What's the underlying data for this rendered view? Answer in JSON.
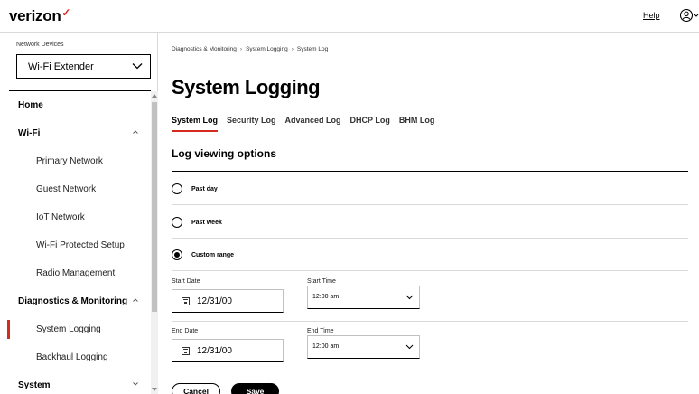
{
  "header": {
    "logo": "verizon",
    "help_label": "Help"
  },
  "sidebar": {
    "network_devices_label": "Network Devices",
    "device_selected": "Wi-Fi Extender",
    "items": [
      {
        "label": "Home",
        "level": "top"
      },
      {
        "label": "Wi-Fi",
        "level": "top",
        "caret": "up"
      },
      {
        "label": "Primary Network",
        "level": "sub"
      },
      {
        "label": "Guest Network",
        "level": "sub"
      },
      {
        "label": "IoT Network",
        "level": "sub"
      },
      {
        "label": "Wi-Fi Protected Setup",
        "level": "sub"
      },
      {
        "label": "Radio Management",
        "level": "sub"
      },
      {
        "label": "Diagnostics & Monitoring",
        "level": "top",
        "caret": "up"
      },
      {
        "label": "System Logging",
        "level": "sub",
        "active": true
      },
      {
        "label": "Backhaul Logging",
        "level": "sub"
      },
      {
        "label": "System",
        "level": "top",
        "caret": "down"
      }
    ]
  },
  "breadcrumb": [
    "Diagnostics & Monitoring",
    "System Logging",
    "System Log"
  ],
  "page_title": "System Logging",
  "tabs": [
    {
      "label": "System Log",
      "active": true
    },
    {
      "label": "Security Log"
    },
    {
      "label": "Advanced Log"
    },
    {
      "label": "DHCP Log"
    },
    {
      "label": "BHM Log"
    }
  ],
  "log_options": {
    "title": "Log viewing options",
    "past_day": "Past day",
    "past_week": "Past week",
    "custom_range": "Custom range",
    "selected": "custom_range"
  },
  "start": {
    "date_label": "Start Date",
    "date_value": "12/31/00",
    "time_label": "Start Time",
    "time_value": "12:00 am"
  },
  "end": {
    "date_label": "End Date",
    "date_value": "12/31/00",
    "time_label": "End Time",
    "time_value": "12:00 am"
  },
  "buttons": {
    "cancel": "Cancel",
    "save": "Save"
  },
  "colors": {
    "accent": "#d52b1e",
    "text": "#000000",
    "divider": "#d8dada"
  }
}
